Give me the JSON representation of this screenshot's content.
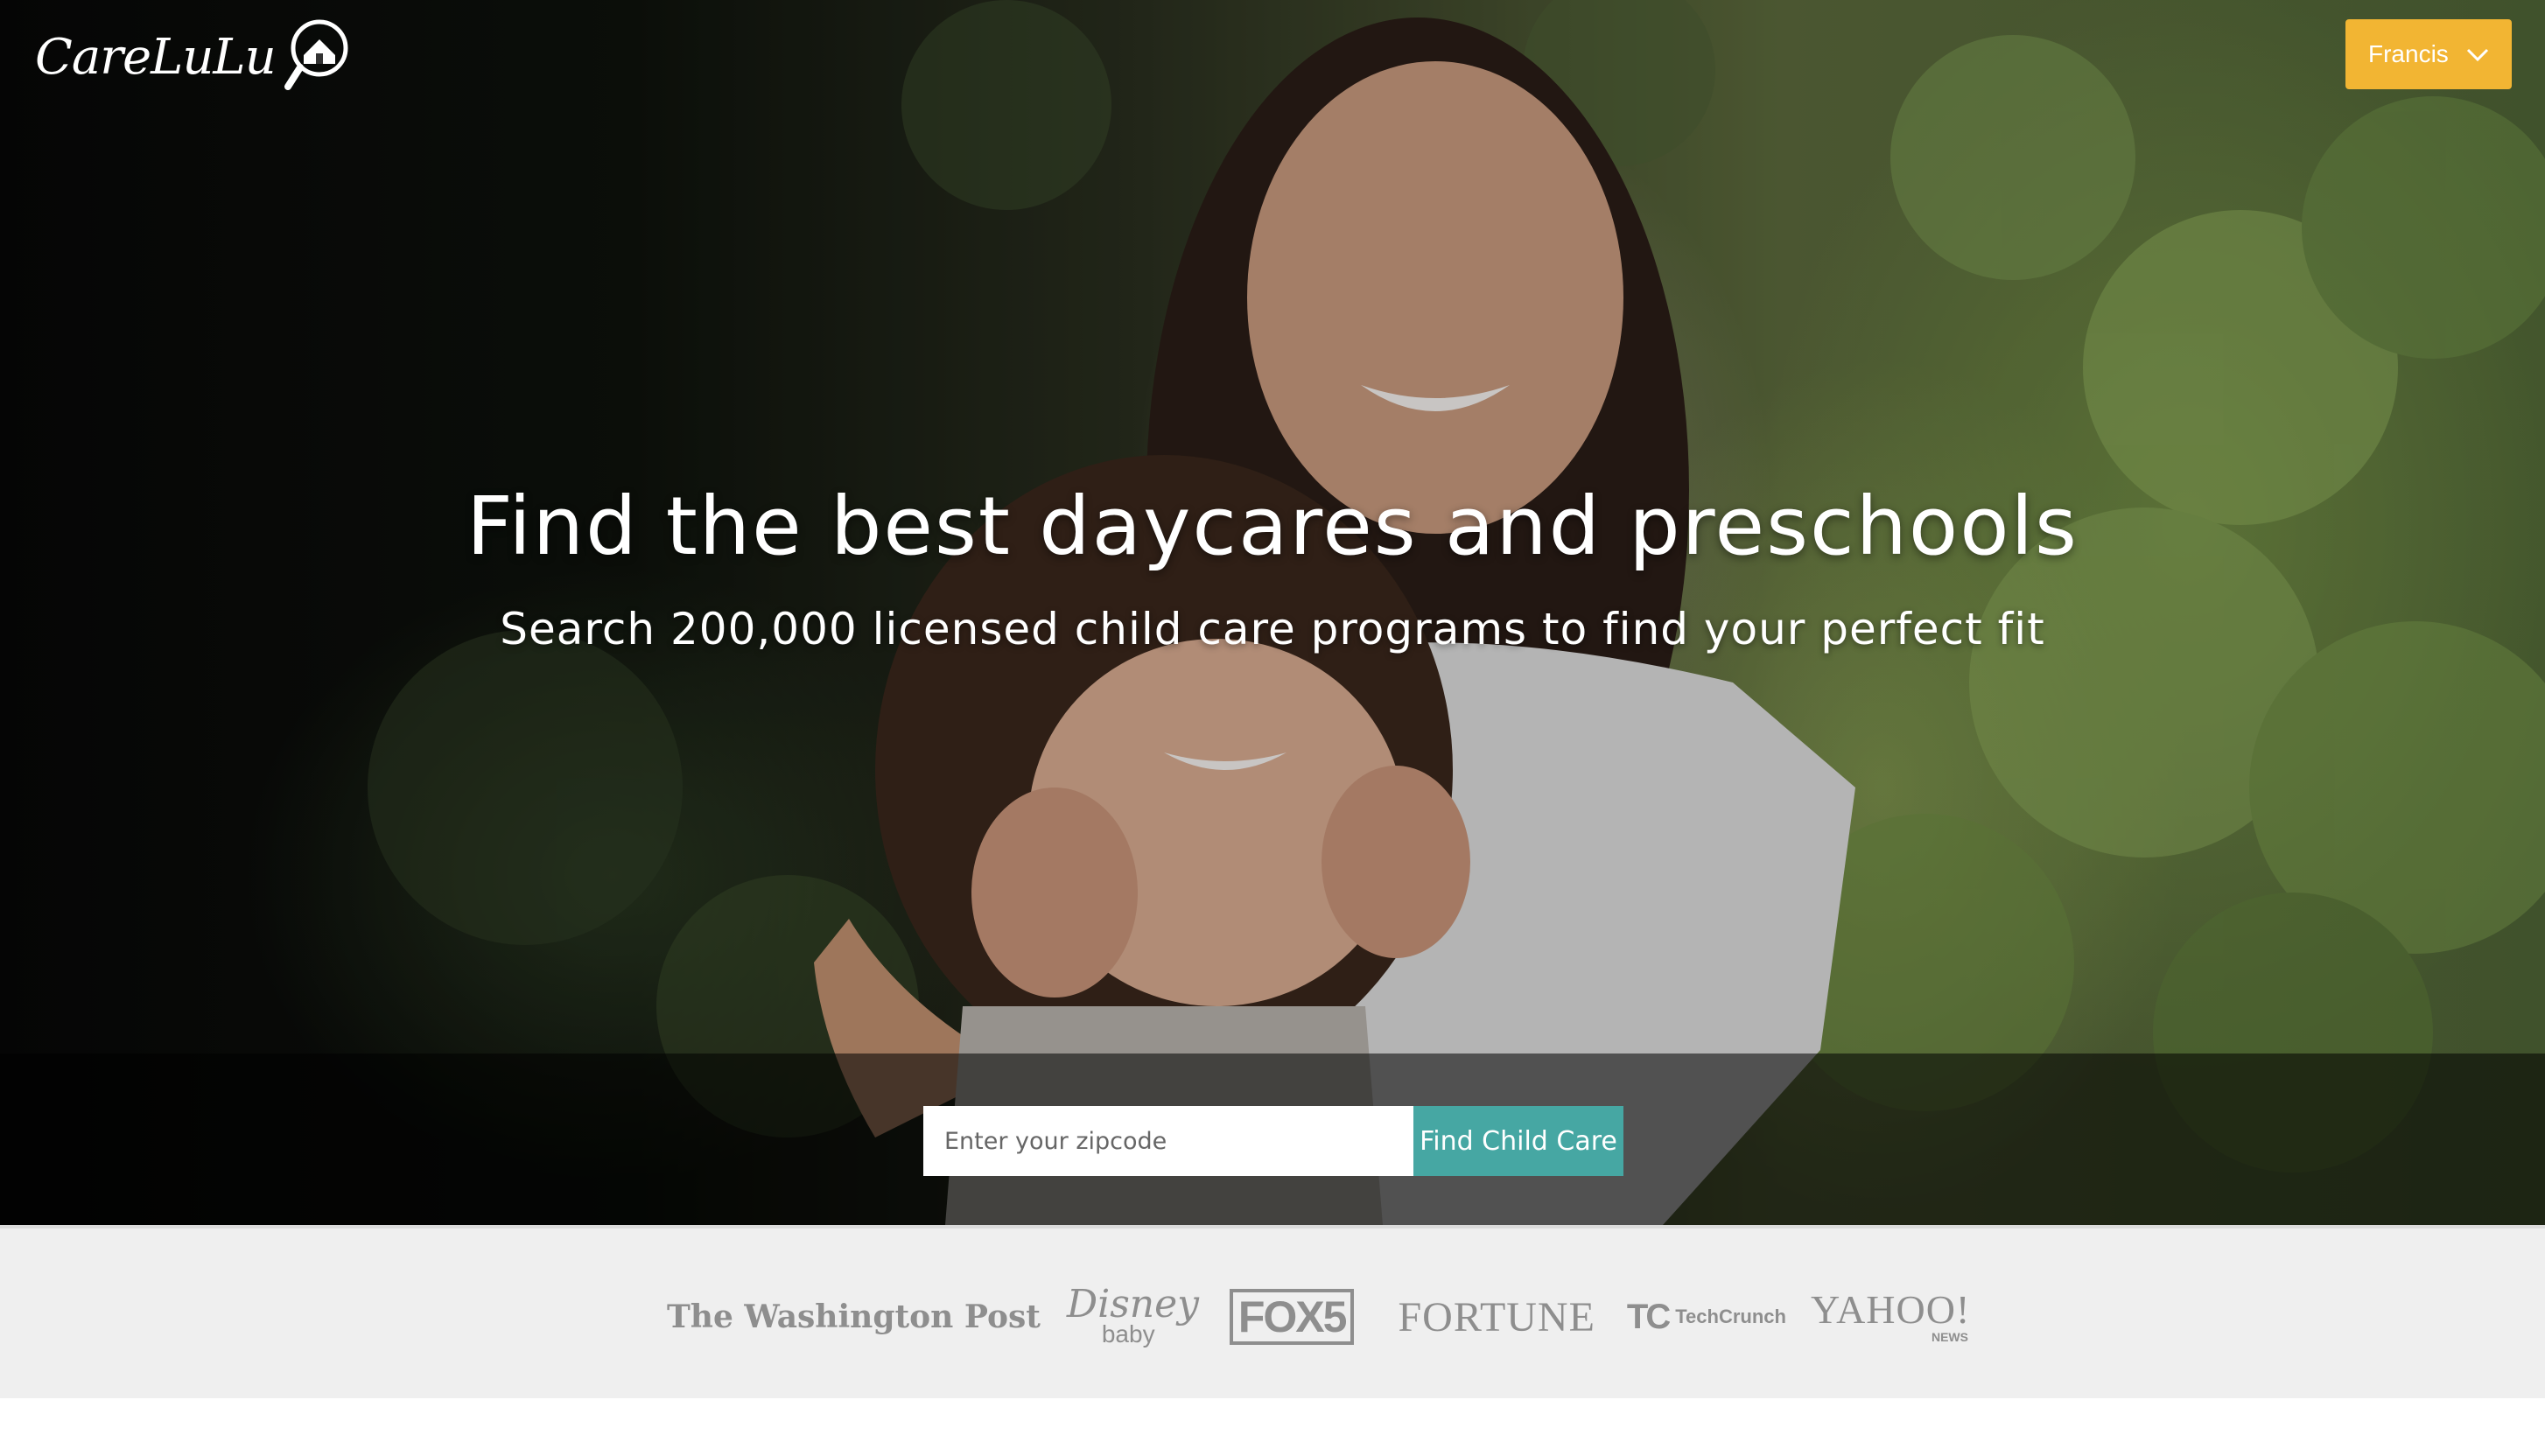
{
  "brand": {
    "name": "CareLuLu",
    "logo_icon": "magnifier-house-icon"
  },
  "user_menu": {
    "label": "Francis",
    "icon": "chevron-down-icon",
    "color": "#f2b533"
  },
  "hero": {
    "title": "Find the best daycares and preschools",
    "subtitle": "Search 200,000 licensed child care programs to find your perfect fit",
    "image_description_icon": "children-photo"
  },
  "search": {
    "placeholder": "Enter your zipcode",
    "value": "",
    "button_label": "Find Child Care",
    "button_color": "#46a7a3"
  },
  "press": {
    "washington_post": "The Washington Post",
    "disney": "Disney",
    "disney_sub": "baby",
    "fox": "FOX5",
    "fortune": "FORTUNE",
    "techcrunch_mark": "TC",
    "techcrunch": "TechCrunch",
    "yahoo": "YAHOO!",
    "yahoo_sub": "NEWS"
  }
}
